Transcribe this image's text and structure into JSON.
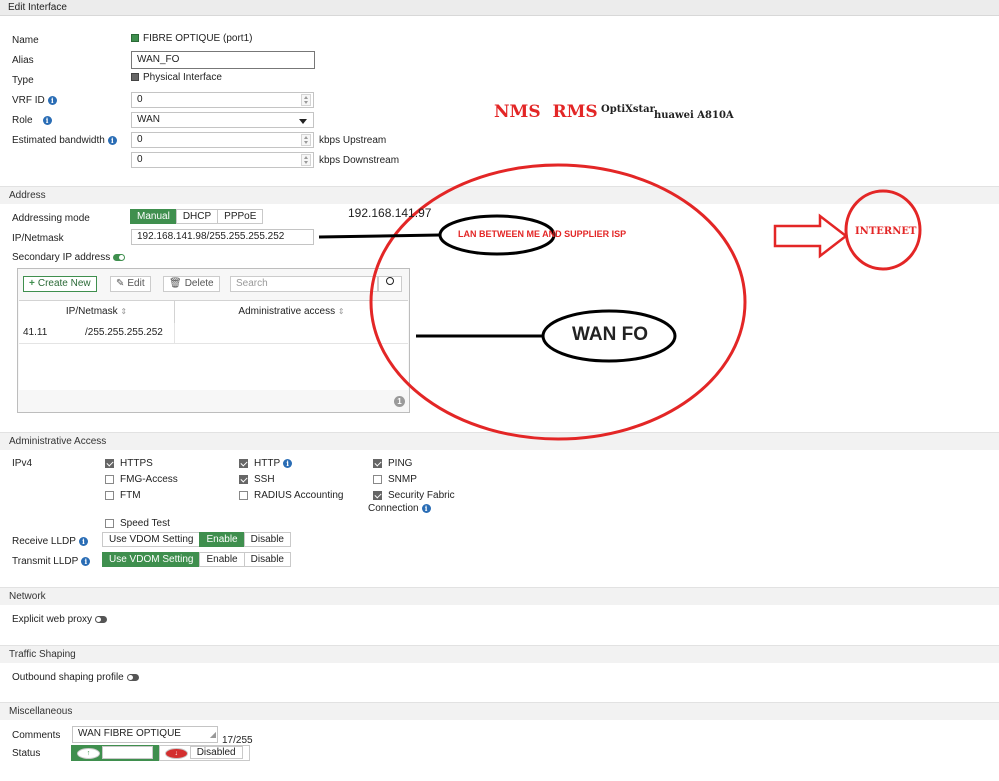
{
  "title": "Edit Interface",
  "form": {
    "name_label": "Name",
    "name_value": "FIBRE OPTIQUE (port1)",
    "alias_label": "Alias",
    "alias_value": "WAN_FO",
    "type_label": "Type",
    "type_value": "Physical Interface",
    "vrf_label": "VRF ID",
    "vrf_value": "0",
    "role_label": "Role",
    "role_value": "WAN",
    "bandwidth_label": "Estimated bandwidth",
    "upstream_value": "0",
    "upstream_unit": "kbps Upstream",
    "downstream_value": "0",
    "downstream_unit": "kbps Downstream"
  },
  "address": {
    "section": "Address",
    "mode_label": "Addressing mode",
    "modes": [
      "Manual",
      "DHCP",
      "PPPoE"
    ],
    "mode_selected": "Manual",
    "ip_label": "IP/Netmask",
    "ip_value": "192.168.141.98/255.255.255.252",
    "secondary_label": "Secondary IP address",
    "secondary_enabled": true,
    "toolbar": {
      "create": "Create New",
      "edit": "Edit",
      "delete": "Delete",
      "search_placeholder": "Search"
    },
    "table": {
      "headers": [
        "IP/Netmask",
        "Administrative access"
      ],
      "rows": [
        {
          "ip": "41.11",
          "mask": "/255.255.255.252",
          "access": ""
        }
      ],
      "count": "1"
    }
  },
  "admin_access": {
    "section": "Administrative Access",
    "ipv4_label": "IPv4",
    "options": [
      {
        "label": "HTTPS",
        "checked": true
      },
      {
        "label": "HTTP",
        "checked": true
      },
      {
        "label": "PING",
        "checked": true
      },
      {
        "label": "FMG-Access",
        "checked": false
      },
      {
        "label": "SSH",
        "checked": true
      },
      {
        "label": "SNMP",
        "checked": false
      },
      {
        "label": "FTM",
        "checked": false
      },
      {
        "label": "RADIUS Accounting",
        "checked": false
      },
      {
        "label": "Security Fabric",
        "checked": true
      },
      {
        "label": "Speed Test",
        "checked": false
      }
    ],
    "fabric_line2": "Connection",
    "receive_lldp_label": "Receive LLDP",
    "transmit_lldp_label": "Transmit LLDP",
    "lldp_options": [
      "Use VDOM Setting",
      "Enable",
      "Disable"
    ],
    "receive_selected": "Enable",
    "transmit_selected": "Use VDOM Setting"
  },
  "network": {
    "section": "Network",
    "proxy_label": "Explicit web proxy",
    "proxy_enabled": false
  },
  "traffic": {
    "section": "Traffic Shaping",
    "outbound_label": "Outbound shaping profile",
    "outbound_enabled": false
  },
  "misc": {
    "section": "Miscellaneous",
    "comments_label": "Comments",
    "comments_value": "WAN FIBRE OPTIQUE",
    "comments_count": "17/255",
    "status_label": "Status",
    "status_enabled": "Enabled",
    "status_disabled": "Disabled",
    "status_selected": "Enabled"
  },
  "annotations": {
    "nms_rms": "NMS  RMS",
    "optixstar": "OptiXstar",
    "huawei": "huawei A810A",
    "gateway_ip": "192.168.141.97",
    "lan_between": "LAN BETWEEN ME AND SUPPLIER ISP",
    "internet": "INTERNET",
    "wan_fo": "WAN FO",
    "color_red": "#e32626"
  }
}
